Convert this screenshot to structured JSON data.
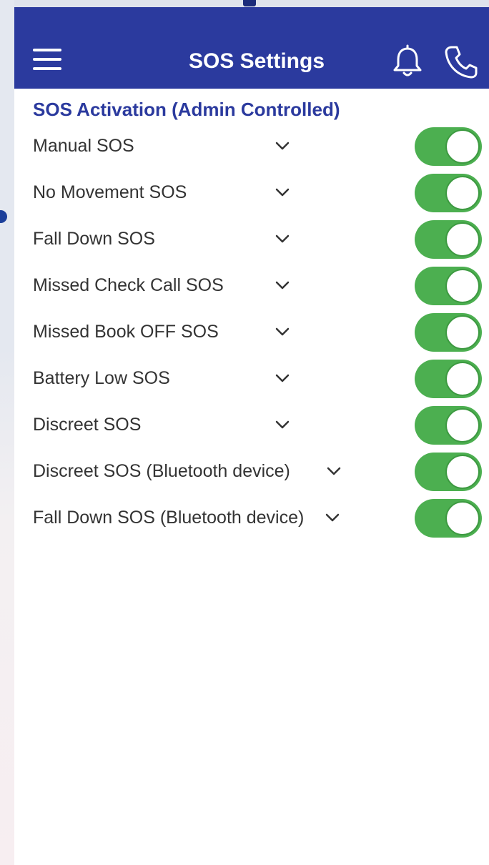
{
  "header": {
    "title": "SOS Settings",
    "menu_icon": "hamburger-menu-icon",
    "bell_icon": "bell-icon",
    "phone_icon": "phone-icon",
    "bar_color": "#2b3a9e"
  },
  "section": {
    "title": "SOS Activation (Admin Controlled)"
  },
  "sos_items": [
    {
      "label": "Manual SOS",
      "enabled": true
    },
    {
      "label": "No Movement SOS",
      "enabled": true
    },
    {
      "label": "Fall Down SOS",
      "enabled": true
    },
    {
      "label": "Missed Check Call SOS",
      "enabled": true
    },
    {
      "label": "Missed Book OFF SOS",
      "enabled": true
    },
    {
      "label": "Battery Low SOS",
      "enabled": true
    },
    {
      "label": "Discreet SOS",
      "enabled": true
    },
    {
      "label": "Discreet SOS (Bluetooth device)",
      "enabled": true
    },
    {
      "label": "Fall Down SOS (Bluetooth device)",
      "enabled": true
    }
  ],
  "colors": {
    "toggle_on": "#4caf50",
    "section_title": "#2b3a9e"
  }
}
